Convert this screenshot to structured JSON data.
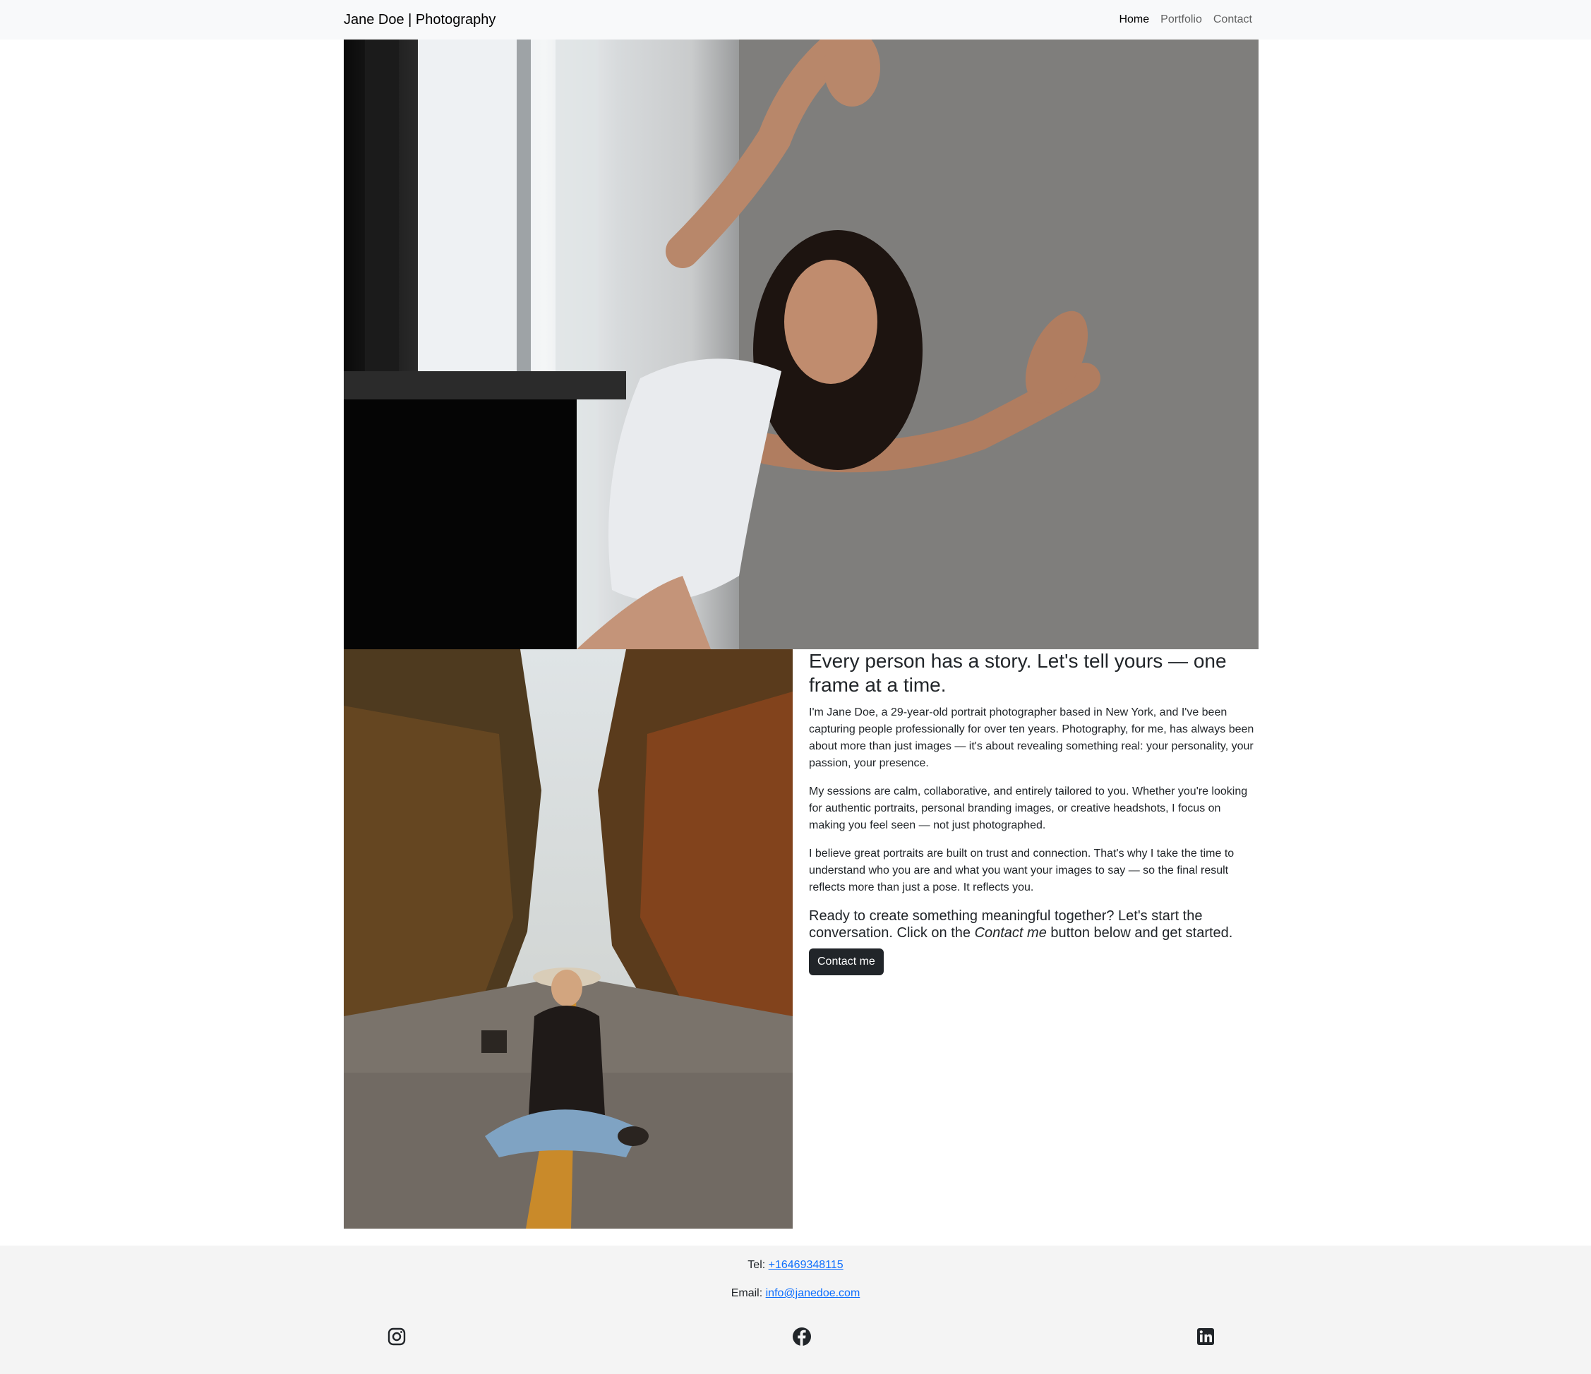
{
  "nav": {
    "brand": "Jane Doe | Photography",
    "links": [
      {
        "label": "Home",
        "active": true
      },
      {
        "label": "Portfolio",
        "active": false
      },
      {
        "label": "Contact",
        "active": false
      }
    ]
  },
  "about": {
    "headline": "Every person has a story. Let's tell yours — one frame at a time.",
    "paragraphs": [
      "I'm Jane Doe, a 29-year-old portrait photographer based in New York, and I've been capturing people professionally for over ten years. Photography, for me, has always been about more than just images — it's about revealing something real: your personality, your passion, your presence.",
      "My sessions are calm, collaborative, and entirely tailored to you. Whether you're looking for authentic portraits, personal branding images, or creative headshots, I focus on making you feel seen — not just photographed.",
      "I believe great portraits are built on trust and connection. That's why I take the time to understand who you are and what you want your images to say — so the final result reflects more than just a pose. It reflects you."
    ],
    "cta_before": "Ready to create something meaningful together? Let's start the conversation. Click on the ",
    "cta_em": "Contact me",
    "cta_after": " button below and get started.",
    "button_label": "Contact me"
  },
  "footer": {
    "tel_label": "Tel: ",
    "tel_value": "+16469348115",
    "email_label": "Email: ",
    "email_value": "info@janedoe.com",
    "social_icons": [
      "instagram-icon",
      "facebook-icon",
      "linkedin-icon"
    ]
  }
}
